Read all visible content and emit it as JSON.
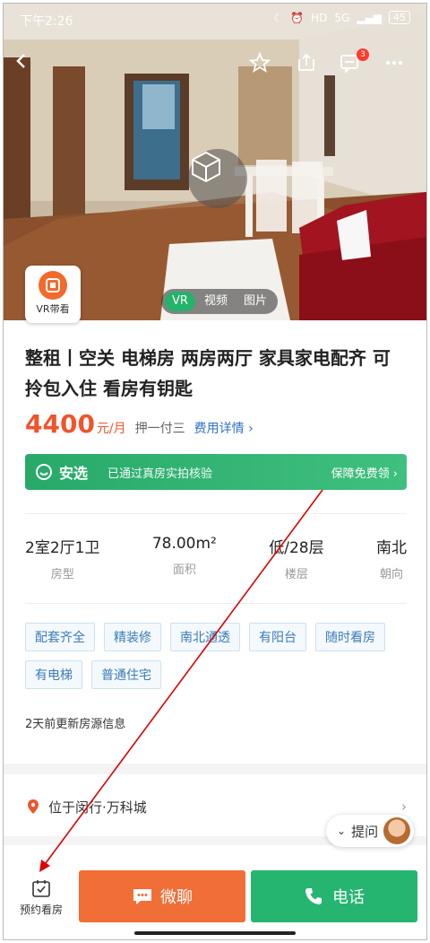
{
  "status_bar": {
    "time": "下午2:26",
    "network": "5G",
    "hd": "HD",
    "battery": "45"
  },
  "hero": {
    "message_badge": "3",
    "media_tabs": [
      "VR",
      "视频",
      "图片"
    ],
    "vr_guide_label": "VR带看"
  },
  "listing": {
    "title": "整租丨空关 电梯房 两房两厅 家具家电配齐 可拎包入住 看房有钥匙",
    "price": "4400",
    "price_unit": "元/月",
    "payment": "押一付三",
    "fee_details": "费用详情 ›",
    "secure": {
      "brand": "安选",
      "verified": "已通过真房实拍核验",
      "guarantee": "保障免费领 ›"
    },
    "specs": [
      {
        "value": "2室2厅1卫",
        "label": "房型"
      },
      {
        "value": "78.00m²",
        "label": "面积"
      },
      {
        "value": "低/28层",
        "label": "楼层"
      },
      {
        "value": "南北",
        "label": "朝向"
      }
    ],
    "tags": [
      "配套齐全",
      "精装修",
      "南北通透",
      "有阳台",
      "随时看房",
      "有电梯",
      "普通住宅"
    ],
    "updated": "2天前更新房源信息",
    "location": "位于闵行·万科城",
    "ask_label": "提问"
  },
  "bottom_bar": {
    "book_label": "预约看房",
    "chat_label": "微聊",
    "call_label": "电话"
  },
  "colors": {
    "accent_orange": "#f26e37",
    "accent_green": "#25b571",
    "price": "#f0542d",
    "link": "#3072c8"
  }
}
